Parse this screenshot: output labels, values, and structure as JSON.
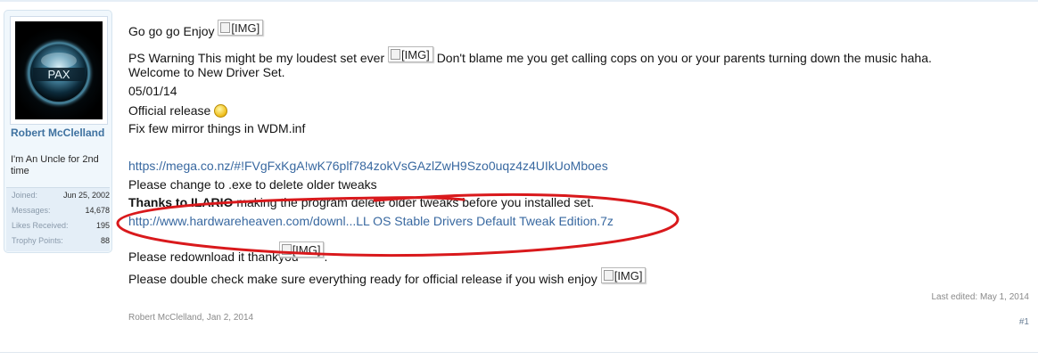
{
  "user": {
    "avatar_text": "PAX",
    "name": "Robert McClelland",
    "title": "I'm An Uncle for 2nd time",
    "stats": [
      {
        "label": "Joined:",
        "value": "Jun 25, 2002"
      },
      {
        "label": "Messages:",
        "value": "14,678"
      },
      {
        "label": "Likes Received:",
        "value": "195"
      },
      {
        "label": "Trophy Points:",
        "value": "88"
      }
    ]
  },
  "message": {
    "line1": "Go go go Enjoy",
    "line2_before": "PS Warning This might be my loudest set ever",
    "line2_after": "Don't blame me you get calling cops on you or your parents turning down the music haha.",
    "line3": "Welcome to New Driver Set.",
    "line4": "05/01/14",
    "line5": "Official release",
    "line6": "Fix few mirror things in WDM.inf",
    "mega_link": "https://mega.co.nz/#!FVgFxKgA!wK76plf784zokVsGAzlZwH9Szo0uqz4z4UIkUoMboes",
    "line8": "Please change to .exe to delete older tweaks",
    "thanks_bold": "Thanks to ILARIO",
    "thanks_rest": "making the program delete older tweaks before you installed set.",
    "hwh_link": "http://www.hardwareheaven.com/downl...LL OS Stable Drivers Default Tweak Edition.7z",
    "redownload": "Please redownload it thankyou",
    "redownload_after": ".",
    "final": "Please double check make sure everything ready for official release if you wish enjoy",
    "img_label": "[IMG]"
  },
  "meta": {
    "last_edited": "Last edited: May 1, 2014",
    "author_date": "Robert McClelland, Jan 2, 2014",
    "post_number": "#1"
  },
  "colors": {
    "link": "#3868a0",
    "annotation_ellipse": "#d9191c",
    "username": "#3f72a0"
  }
}
